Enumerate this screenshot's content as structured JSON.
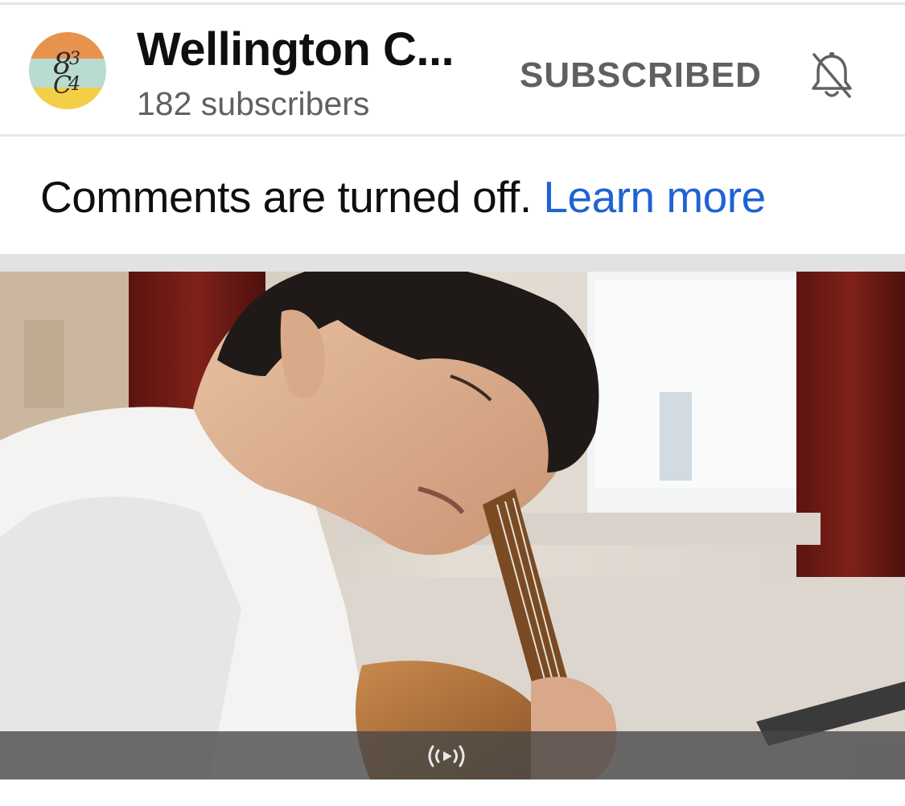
{
  "channel": {
    "name": "Wellington C...",
    "subscribers": "182 subscribers",
    "avatar_icon": "channel-logo-834",
    "subscribe_label": "SUBSCRIBED",
    "bell_icon": "bell-off-icon"
  },
  "comments": {
    "message": "Comments are turned off.",
    "link": "Learn more",
    "link_color": "#1f63d4"
  },
  "video": {
    "thumbnail_icon": "guitarist-thumbnail",
    "overlay_icon": "live-broadcast-icon"
  }
}
